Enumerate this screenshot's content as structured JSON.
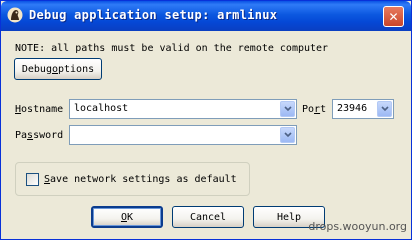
{
  "window": {
    "title": "Debug application setup: armlinux",
    "close_glyph": "✕"
  },
  "note": "NOTE: all paths must be valid on the remote computer",
  "buttons": {
    "debug_options": {
      "pre": "Debug ",
      "mnemonic": "o",
      "post": "ptions"
    },
    "ok": {
      "pre": "",
      "mnemonic": "O",
      "post": "K"
    },
    "cancel": "Cancel",
    "help": "Help"
  },
  "fields": {
    "hostname": {
      "pre": "",
      "mnemonic": "H",
      "post": "ostname",
      "value": "localhost"
    },
    "port": {
      "pre": "Po",
      "mnemonic": "r",
      "post": "t",
      "value": "23946"
    },
    "password": {
      "pre": "Pa",
      "mnemonic": "s",
      "post": "sword",
      "value": ""
    }
  },
  "save_default": {
    "pre": "",
    "mnemonic": "S",
    "post": "ave network settings as default",
    "checked": false
  },
  "watermark": "drops.wooyun.org",
  "colors": {
    "titlebar": "#0548d6",
    "dialog_bg": "#ece9d8",
    "button_border": "#003c74",
    "input_border": "#7f9db9"
  }
}
